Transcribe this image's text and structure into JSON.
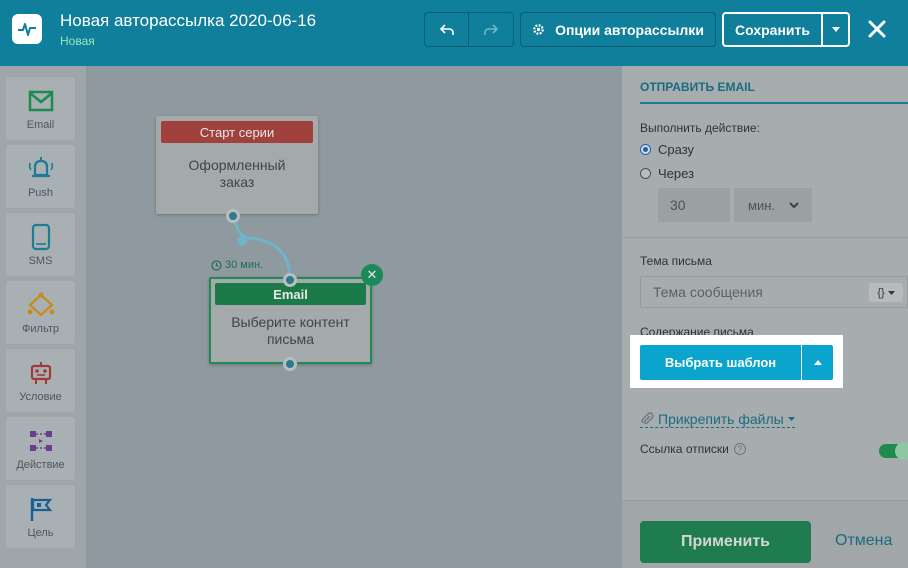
{
  "header": {
    "title": "Новая авторассылка 2020-06-16",
    "status": "Новая",
    "options_label": "Опции авторассылки",
    "save_label": "Сохранить"
  },
  "palette": {
    "items": [
      {
        "label": "Email",
        "icon": "envelope-icon",
        "color": "#1e8a4f"
      },
      {
        "label": "Push",
        "icon": "bell-icon",
        "color": "#1a7d94"
      },
      {
        "label": "SMS",
        "icon": "phone-icon",
        "color": "#1a7d94"
      },
      {
        "label": "Фильтр",
        "icon": "filter-icon",
        "color": "#c98a1a"
      },
      {
        "label": "Условие",
        "icon": "robot-icon",
        "color": "#a13a36"
      },
      {
        "label": "Действие",
        "icon": "workflow-icon",
        "color": "#6a3d8f"
      },
      {
        "label": "Цель",
        "icon": "flag-icon",
        "color": "#1a5f94"
      }
    ]
  },
  "canvas": {
    "start_node": {
      "header": "Старт серии",
      "body": "Оформленный заказ",
      "header_color": "#a0413e"
    },
    "delay_label": "30 мин.",
    "email_node": {
      "header": "Email",
      "body": "Выберите контент письма",
      "header_color": "#1b7a47"
    }
  },
  "panel": {
    "section_title": "ОТПРАВИТЬ EMAIL",
    "action_label": "Выполнить действие:",
    "radio_immediately": "Сразу",
    "radio_after": "Через",
    "delay_value": "30",
    "delay_unit": "мин.",
    "subject_label": "Тема письма",
    "subject_placeholder": "Тема сообщения",
    "content_label": "Содержание письма",
    "choose_template": "Выбрать шаблон",
    "attach_files": "Прикрепить файлы",
    "unsubscribe_label": "Ссылка отписки",
    "apply_label": "Применить",
    "cancel_label": "Отмена"
  },
  "colors": {
    "header_bg": "#0f7f9b",
    "primary_button": "#0aa4cc",
    "apply_button": "#1e7c4f",
    "accent": "#1a6c81"
  }
}
